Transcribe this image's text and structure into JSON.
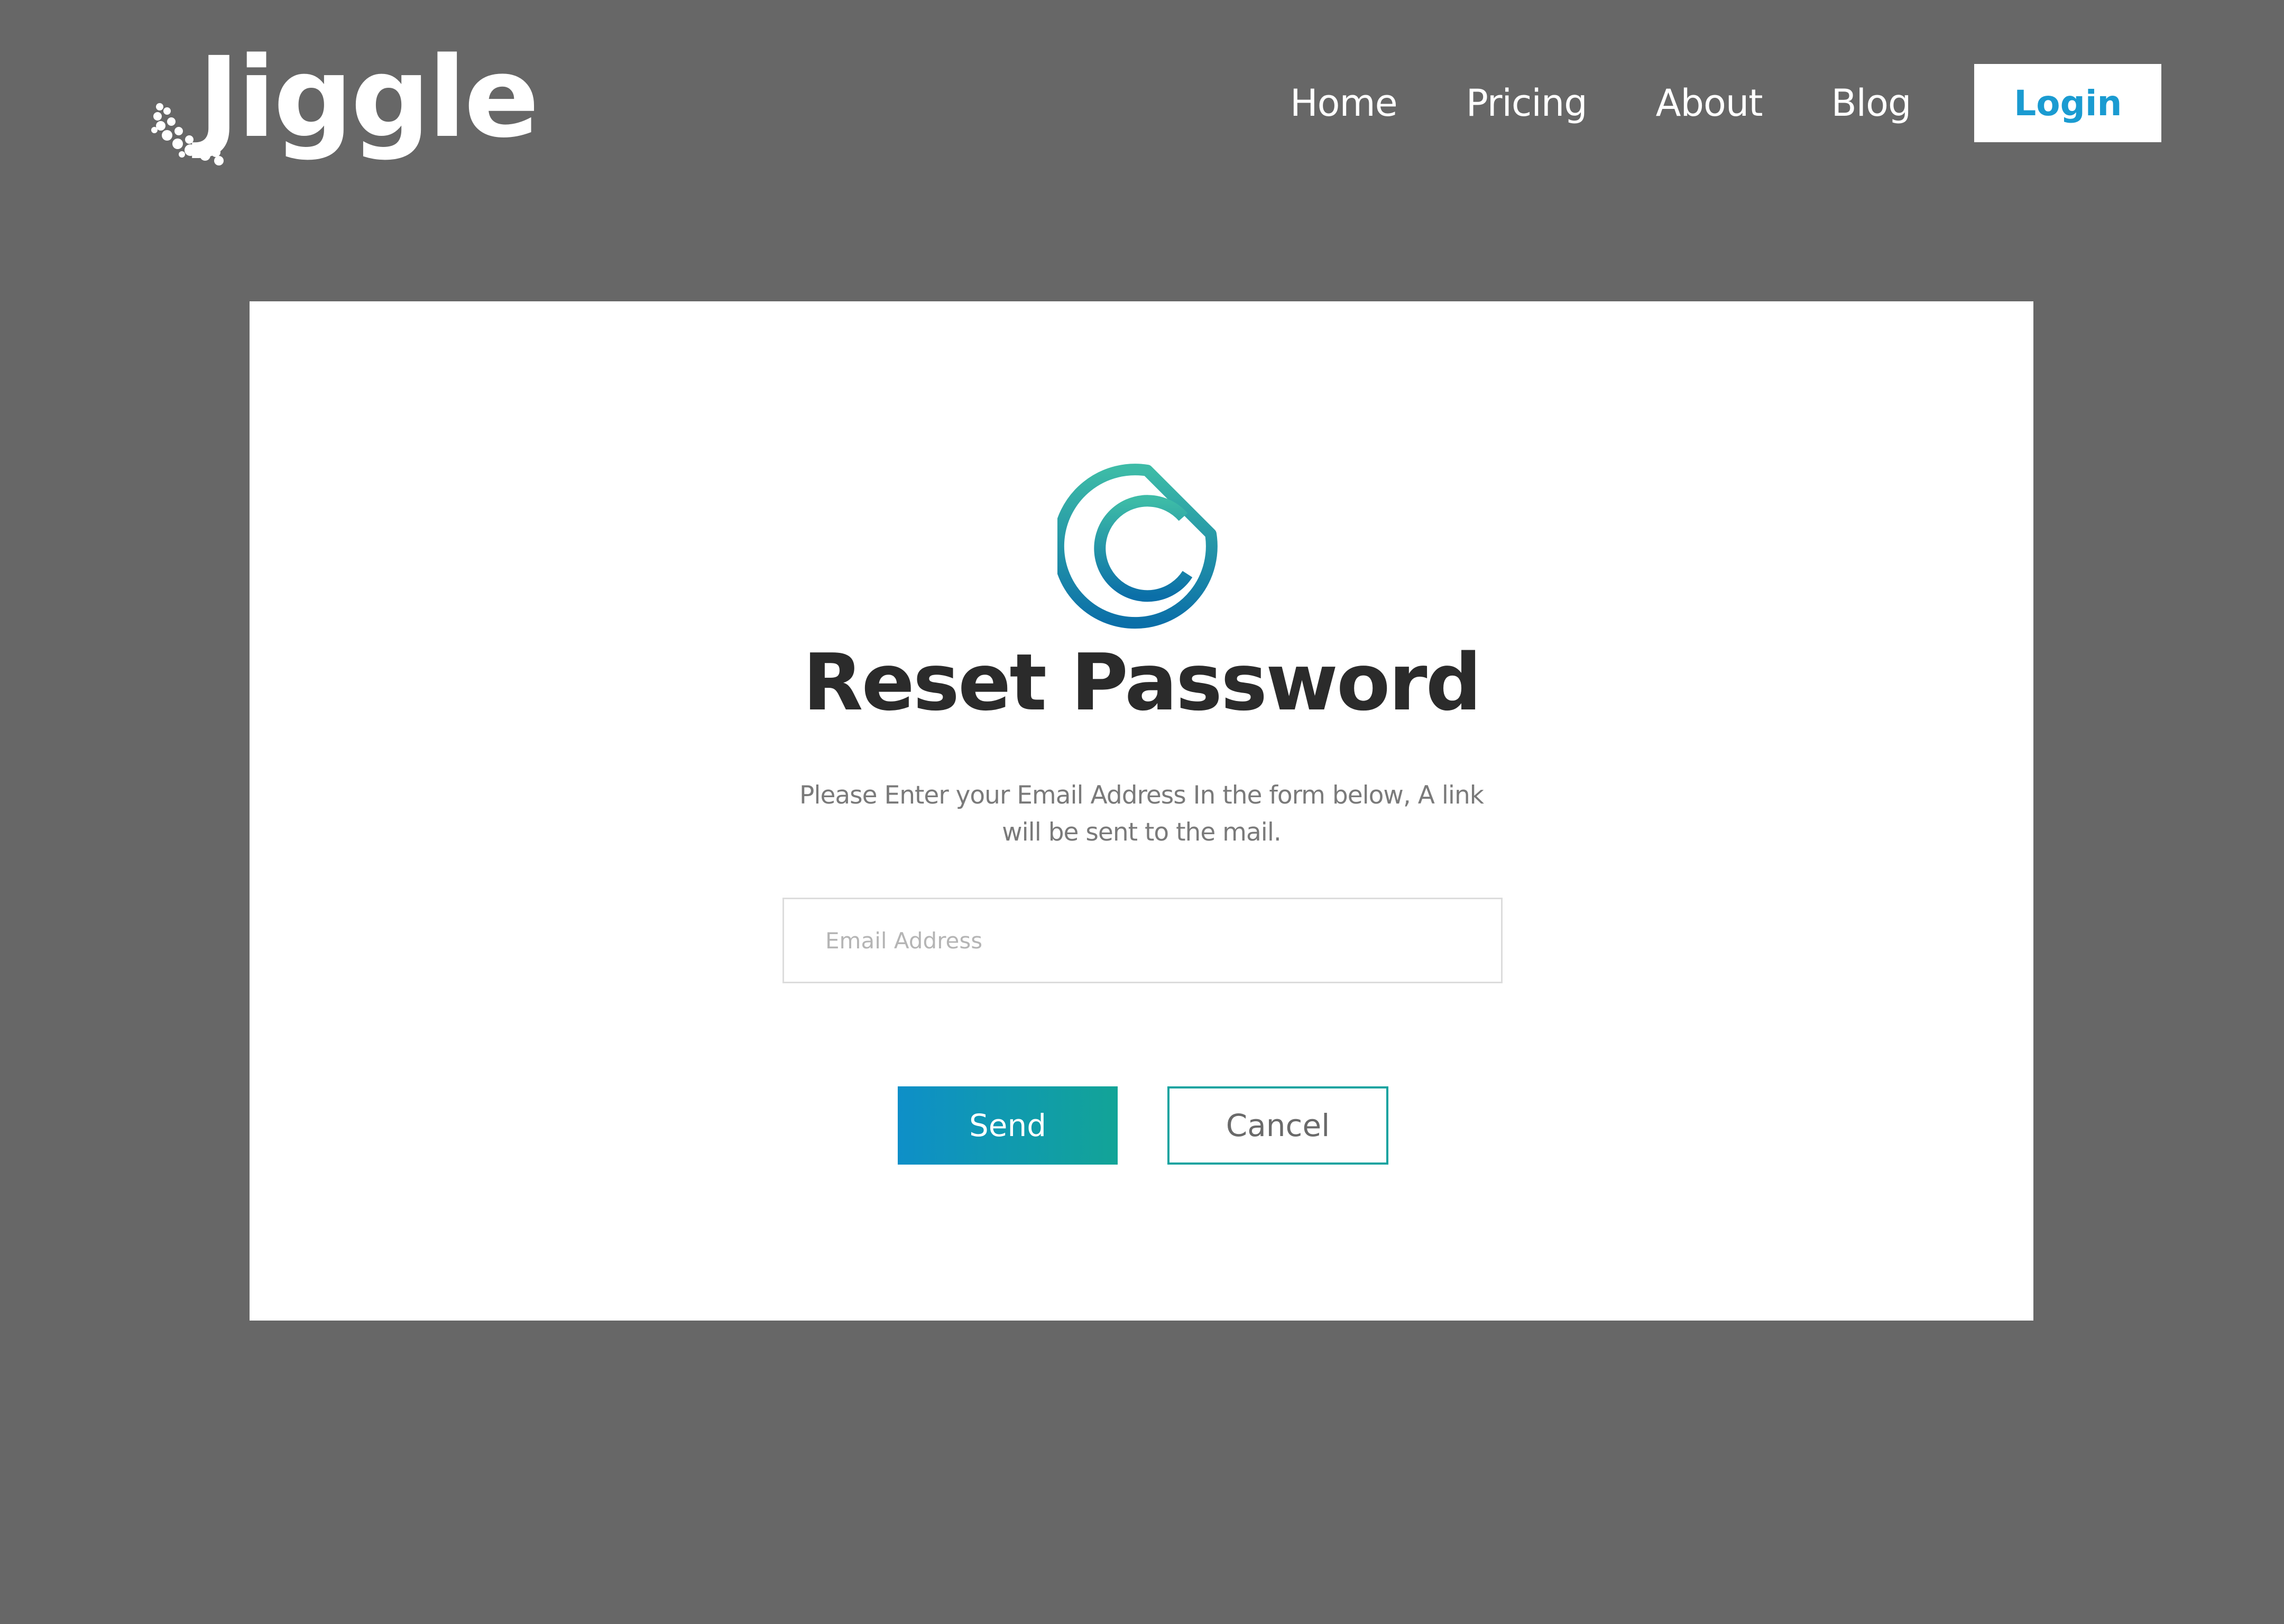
{
  "brand": {
    "name": "Jiggle",
    "logo_icon": "bubble-dots-icon"
  },
  "nav": {
    "items": [
      {
        "label": "Home"
      },
      {
        "label": "Pricing"
      },
      {
        "label": "About"
      },
      {
        "label": "Blog"
      }
    ],
    "login_label": "Login"
  },
  "reset": {
    "logo_icon": "teardrop-c-logo-icon",
    "title": "Reset Password",
    "subtitle": "Please Enter your Email Address In the form below, A link will be sent to the mail.",
    "email_placeholder": "Email Address",
    "email_value": "",
    "send_label": "Send",
    "cancel_label": "Cancel"
  },
  "colors": {
    "page_background": "#676767",
    "card_background": "#ffffff",
    "accent_blue": "#1a9bd1",
    "accent_teal": "#12a497",
    "gradient_start": "#0e8fc8",
    "gradient_end": "#12a497",
    "title_text": "#2b2b2b",
    "muted_text": "#7a7a7a"
  }
}
